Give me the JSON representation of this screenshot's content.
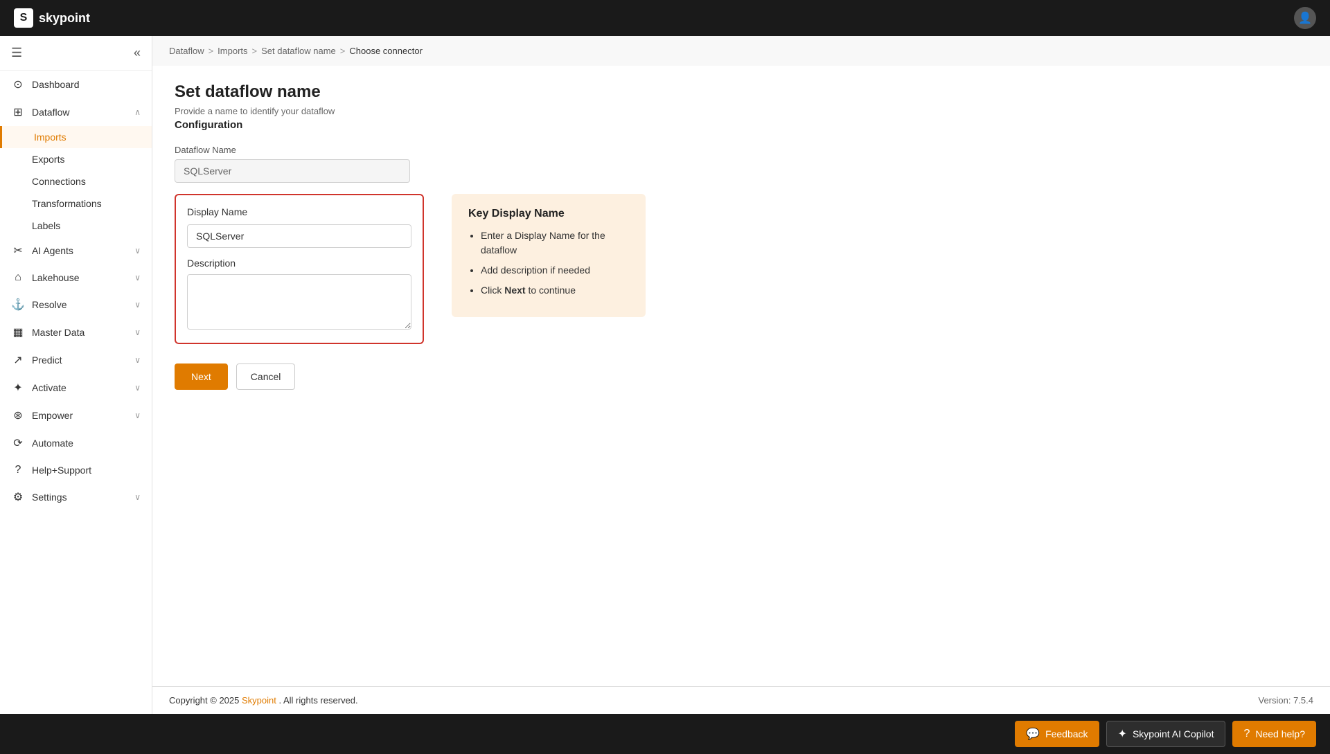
{
  "app": {
    "name": "skypoint",
    "logo_letter": "S"
  },
  "topbar": {
    "brand": "skypoint"
  },
  "breadcrumb": {
    "items": [
      "Dataflow",
      "Imports",
      "Set dataflow name",
      "Choose connector"
    ],
    "separators": [
      ">",
      ">",
      ">"
    ]
  },
  "sidebar": {
    "nav_items": [
      {
        "id": "dashboard",
        "label": "Dashboard",
        "icon": "⊙",
        "has_children": false
      },
      {
        "id": "dataflow",
        "label": "Dataflow",
        "icon": "⊞",
        "has_children": true,
        "expanded": true
      },
      {
        "id": "ai-agents",
        "label": "AI Agents",
        "icon": "✂",
        "has_children": true
      },
      {
        "id": "lakehouse",
        "label": "Lakehouse",
        "icon": "⌂",
        "has_children": true
      },
      {
        "id": "resolve",
        "label": "Resolve",
        "icon": "⚓",
        "has_children": true
      },
      {
        "id": "master-data",
        "label": "Master Data",
        "icon": "▦",
        "has_children": true
      },
      {
        "id": "predict",
        "label": "Predict",
        "icon": "↗",
        "has_children": true
      },
      {
        "id": "activate",
        "label": "Activate",
        "icon": "✦",
        "has_children": true
      },
      {
        "id": "empower",
        "label": "Empower",
        "icon": "⊛",
        "has_children": true
      },
      {
        "id": "automate",
        "label": "Automate",
        "icon": "⟳",
        "has_children": false
      },
      {
        "id": "help-support",
        "label": "Help+Support",
        "icon": "?",
        "has_children": false
      },
      {
        "id": "settings",
        "label": "Settings",
        "icon": "⚙",
        "has_children": true
      }
    ],
    "sub_items": [
      {
        "id": "imports",
        "label": "Imports",
        "parent": "dataflow",
        "active": true
      },
      {
        "id": "exports",
        "label": "Exports",
        "parent": "dataflow"
      },
      {
        "id": "connections",
        "label": "Connections",
        "parent": "dataflow"
      },
      {
        "id": "transformations",
        "label": "Transformations",
        "parent": "dataflow"
      },
      {
        "id": "labels",
        "label": "Labels",
        "parent": "dataflow"
      }
    ]
  },
  "page": {
    "title": "Set dataflow name",
    "subtitle": "Provide a name to identify your dataflow",
    "section_label": "Configuration",
    "dataflow_name_label": "Dataflow Name",
    "dataflow_name_value": "SQLServer",
    "display_name_label": "Display Name",
    "display_name_value": "SQLServer",
    "description_label": "Description",
    "description_placeholder": ""
  },
  "hint_box": {
    "title": "Key Display Name",
    "items": [
      "Enter a Display Name for the dataflow",
      "Add description if needed",
      "Click Next to continue"
    ],
    "bold_words": [
      "Next"
    ]
  },
  "buttons": {
    "next": "Next",
    "cancel": "Cancel"
  },
  "footer": {
    "copyright_text": "Copyright © 2025",
    "brand_link": "Skypoint",
    "rights_text": ". All rights reserved.",
    "version": "Version: 7.5.4"
  },
  "bottom_bar": {
    "feedback_label": "Feedback",
    "copilot_label": "Skypoint AI Copilot",
    "help_label": "Need help?"
  }
}
